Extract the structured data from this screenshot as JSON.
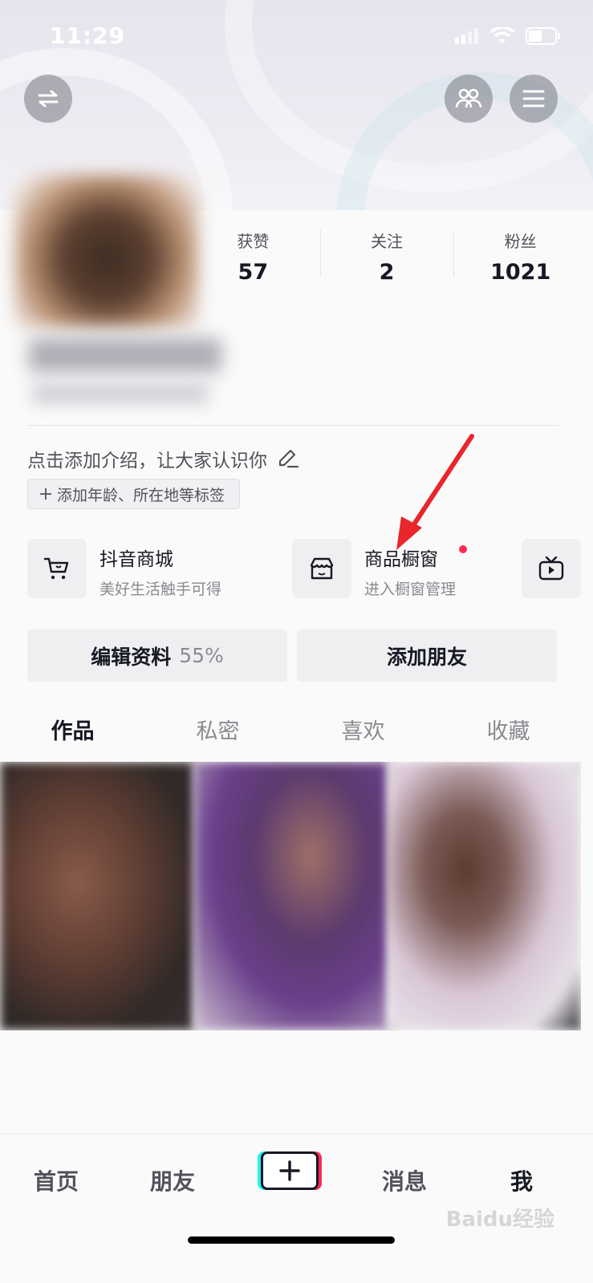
{
  "status_bar": {
    "time": "11:29"
  },
  "stats": [
    {
      "label": "获赞",
      "value": "57"
    },
    {
      "label": "关注",
      "value": "2"
    },
    {
      "label": "粉丝",
      "value": "1021"
    }
  ],
  "bio": {
    "placeholder": "点击添加介绍，让大家认识你"
  },
  "tag_button": {
    "label": "添加年龄、所在地等标签"
  },
  "services": [
    {
      "title": "抖音商城",
      "subtitle": "美好生活触手可得"
    },
    {
      "title": "商品橱窗",
      "subtitle": "进入橱窗管理"
    }
  ],
  "actions": {
    "edit_label": "编辑资料",
    "edit_percent": "55%",
    "add_friend_label": "添加朋友"
  },
  "tabs": [
    "作品",
    "私密",
    "喜欢",
    "收藏"
  ],
  "bottom_nav": {
    "home": "首页",
    "friends": "朋友",
    "messages": "消息",
    "me": "我"
  },
  "watermark": "Baidu经验",
  "colors": {
    "accent_red": "#fe2c55",
    "accent_cyan": "#25f4ee",
    "text_primary": "#161823"
  }
}
